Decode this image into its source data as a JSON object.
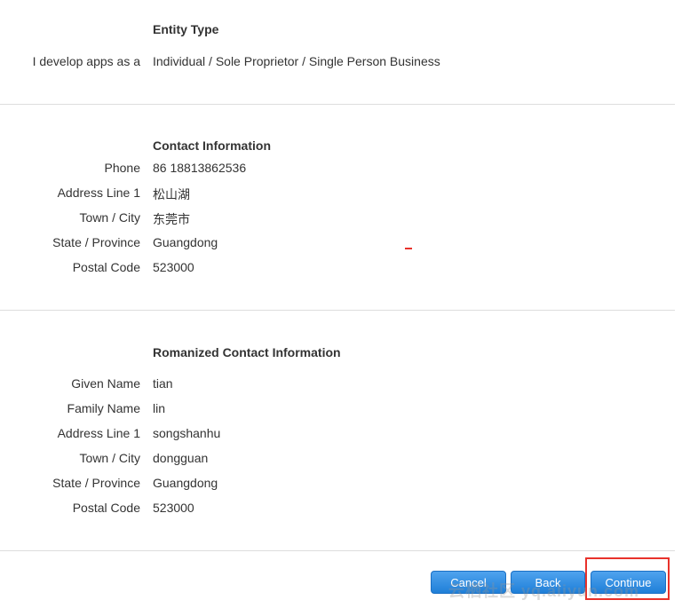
{
  "entity": {
    "title": "Entity Type",
    "label": "I develop apps as a",
    "value": "Individual / Sole Proprietor / Single Person Business"
  },
  "contact": {
    "title": "Contact Information",
    "rows": [
      {
        "label": "Phone",
        "value": "86 18813862536"
      },
      {
        "label": "Address Line 1",
        "value": "松山湖"
      },
      {
        "label": "Town / City",
        "value": "东莞市"
      },
      {
        "label": "State / Province",
        "value": "Guangdong"
      },
      {
        "label": "Postal Code",
        "value": "523000"
      }
    ]
  },
  "romanized": {
    "title": "Romanized Contact Information",
    "rows": [
      {
        "label": "Given Name",
        "value": "tian"
      },
      {
        "label": "Family Name",
        "value": "lin"
      },
      {
        "label": "Address Line 1",
        "value": "songshanhu"
      },
      {
        "label": "Town / City",
        "value": "dongguan"
      },
      {
        "label": "State / Province",
        "value": "Guangdong"
      },
      {
        "label": "Postal Code",
        "value": "523000"
      }
    ]
  },
  "buttons": {
    "cancel": "Cancel",
    "back": "Back",
    "continue": "Continue"
  },
  "watermark": "云栖社区 yq.aliyun.com",
  "colors": {
    "button_blue": "#1f7fd8",
    "highlight_red": "#e8322b",
    "divider": "#dddddd"
  }
}
